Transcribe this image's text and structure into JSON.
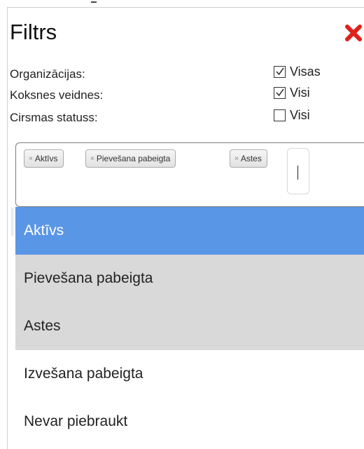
{
  "filter": {
    "title": "Filtrs",
    "rows": [
      {
        "label": "Organizācijas:",
        "checkbox_label": "Visas",
        "checked": true
      },
      {
        "label": "Koksnes veidnes:",
        "checkbox_label": "Visi",
        "checked": true
      },
      {
        "label": "Cirsmas statuss:",
        "checkbox_label": "Visi",
        "checked": false
      }
    ],
    "selected_tags": [
      "Aktīvs",
      "Pievešana pabeigta",
      "Astes"
    ],
    "tag_remove_glyph": "×",
    "options": [
      {
        "label": "Aktīvs",
        "state": "highlighted"
      },
      {
        "label": "Pievešana pabeigta",
        "state": "selected"
      },
      {
        "label": "Astes",
        "state": "selected"
      },
      {
        "label": "Izvešana pabeigta",
        "state": "normal"
      },
      {
        "label": "Nevar piebraukt",
        "state": "normal"
      }
    ]
  },
  "colors": {
    "highlight": "#5a96e6",
    "selected": "#d9d9d9",
    "close_icon": "#e0201b"
  }
}
